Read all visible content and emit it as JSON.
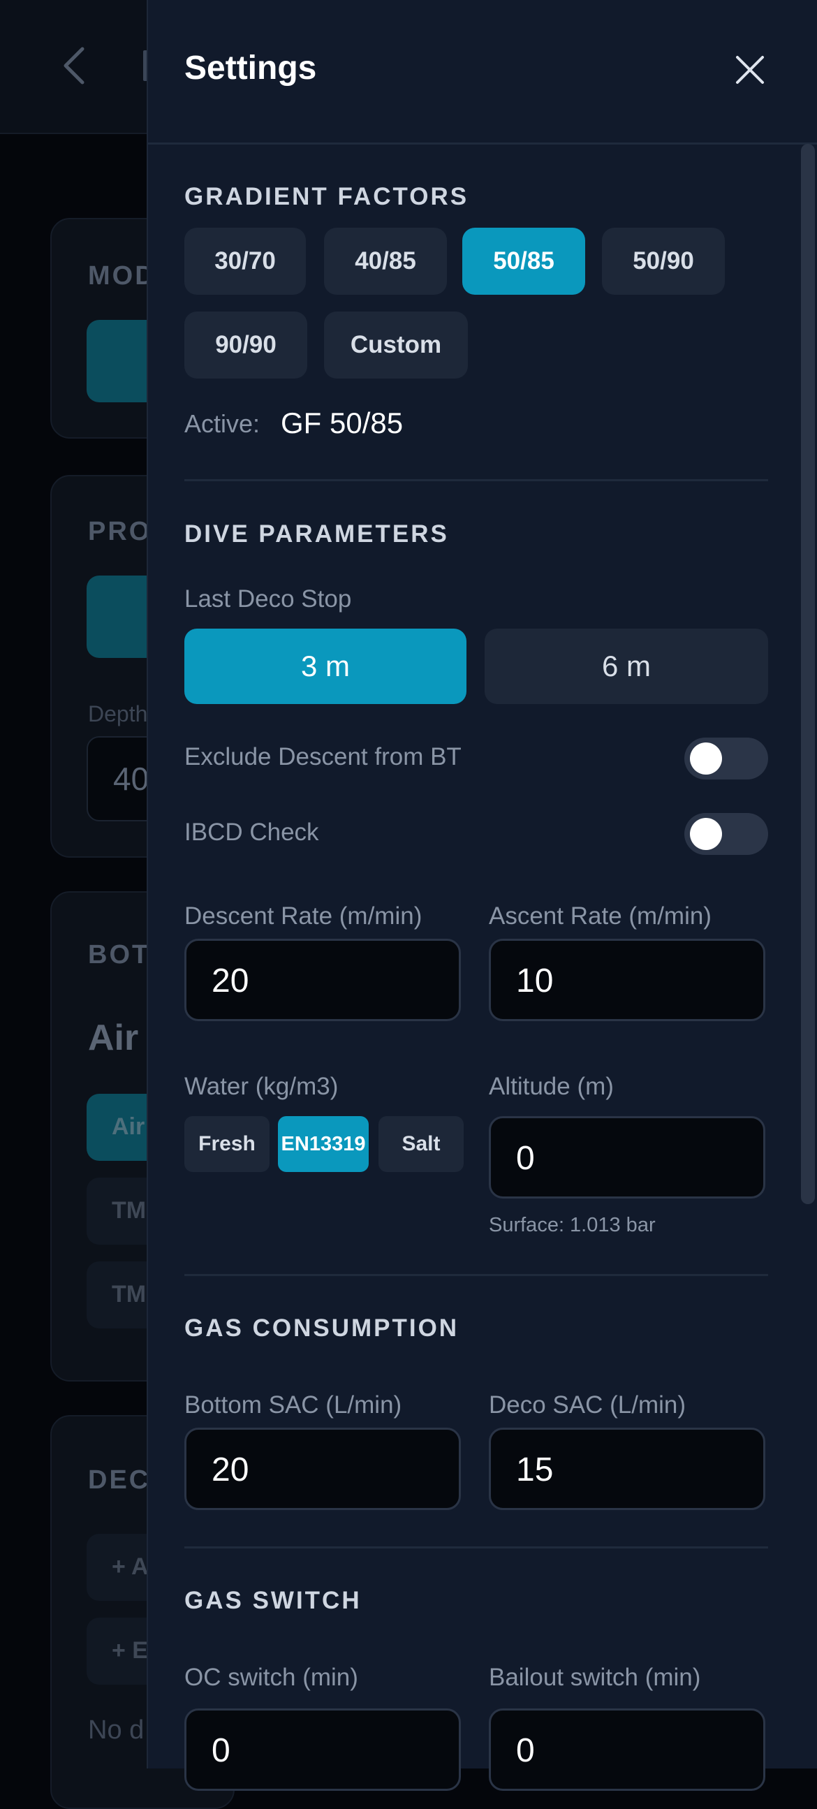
{
  "background": {
    "cards": [
      {
        "label": "MOD"
      },
      {
        "label": "PRO",
        "sub_label": "Depth",
        "value": "40"
      },
      {
        "label": "BOT",
        "gas": "Air",
        "chips": [
          "Air",
          "TM",
          "TM"
        ]
      },
      {
        "label": "DEC",
        "items": [
          "+ A",
          "+ E"
        ],
        "note": "No d"
      }
    ]
  },
  "drawer": {
    "title": "Settings",
    "close_icon": "close-icon",
    "gradient_factors": {
      "title": "GRADIENT FACTORS",
      "options": [
        "30/70",
        "40/85",
        "50/85",
        "50/90",
        "90/90",
        "Custom"
      ],
      "selected": "50/85",
      "active_label": "Active:",
      "active_value": "GF 50/85"
    },
    "dive_parameters": {
      "title": "DIVE PARAMETERS",
      "last_deco_stop": {
        "label": "Last Deco Stop",
        "options": [
          "3 m",
          "6 m"
        ],
        "selected": "3 m"
      },
      "exclude_descent": {
        "label": "Exclude Descent from BT",
        "on": false
      },
      "ibcd_check": {
        "label": "IBCD Check",
        "on": false
      },
      "descent_rate": {
        "label": "Descent Rate (m/min)",
        "value": "20"
      },
      "ascent_rate": {
        "label": "Ascent Rate (m/min)",
        "value": "10"
      },
      "water": {
        "label": "Water (kg/m3)",
        "options": [
          "Fresh",
          "EN13319",
          "Salt"
        ],
        "selected": "EN13319"
      },
      "altitude": {
        "label": "Altitude (m)",
        "value": "0",
        "hint": "Surface: 1.013 bar"
      }
    },
    "gas_consumption": {
      "title": "GAS CONSUMPTION",
      "bottom_sac": {
        "label": "Bottom SAC (L/min)",
        "value": "20"
      },
      "deco_sac": {
        "label": "Deco SAC (L/min)",
        "value": "15"
      }
    },
    "gas_switch": {
      "title": "GAS SWITCH",
      "oc_switch": {
        "label": "OC switch (min)",
        "value": "0"
      },
      "bailout_switch": {
        "label": "Bailout switch (min)",
        "value": "0"
      }
    }
  },
  "colors": {
    "accent": "#0a98bd",
    "drawer_bg": "#111a2b",
    "button_bg": "#1d2738"
  }
}
